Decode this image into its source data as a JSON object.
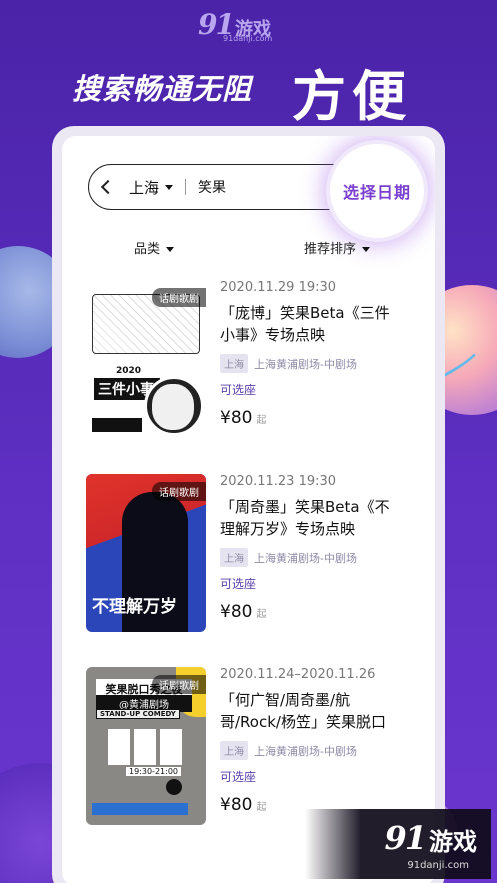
{
  "brand": {
    "logo_num": "91",
    "logo_cn": "游戏",
    "url": "91danji.com"
  },
  "promo": {
    "headline": "搜索畅通无阻",
    "headline_big": "方便"
  },
  "search": {
    "city": "上海",
    "query": "笑果",
    "date_button": "选择日期"
  },
  "filters": {
    "category": "品类",
    "sort": "推荐排序"
  },
  "items": [
    {
      "tag": "话剧歌剧",
      "date": "2020.11.29 19:30",
      "title": "「庞博」笑果Beta《三件小事》专场点映",
      "city": "上海",
      "venue": "上海黄浦剧场-中剧场",
      "status": "可选座",
      "price": "¥80",
      "price_suffix": "起",
      "poster": {
        "year": "2020",
        "name": "三件小事"
      }
    },
    {
      "tag": "话剧歌剧",
      "date": "2020.11.23 19:30",
      "title": "「周奇墨」笑果Beta《不理解万岁》专场点映",
      "city": "上海",
      "venue": "上海黄浦剧场-中剧场",
      "status": "可选座",
      "price": "¥80",
      "price_suffix": "起",
      "poster": {
        "title": "不理解万岁"
      }
    },
    {
      "tag": "话剧歌剧",
      "date": "2020.11.24–2020.11.26",
      "title": "「何广智/周奇墨/航哥/Rock/杨笠」笑果脱口秀...",
      "city": "上海",
      "venue": "上海黄浦剧场-中剧场",
      "status": "可选座",
      "price": "¥80",
      "price_suffix": "起",
      "poster": {
        "title": "笑果脱口秀之夜",
        "subtitle": "@黄浦剧场",
        "en": "STAND-UP COMEDY",
        "time": "19:30-21:00"
      }
    }
  ],
  "watermark": {
    "logo_num": "91",
    "logo_cn": "游戏",
    "url": "91danji.com"
  }
}
